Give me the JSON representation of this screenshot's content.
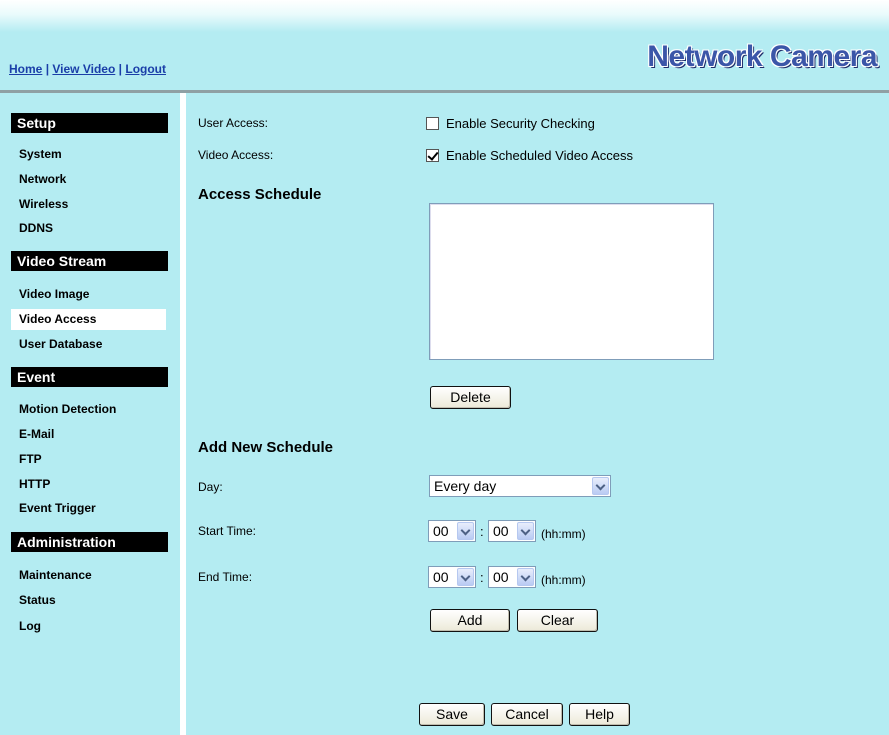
{
  "header": {
    "links": [
      "Home",
      "View Video",
      "Logout"
    ],
    "separator": "|",
    "brand": "Network Camera"
  },
  "sidebar": {
    "sections": [
      {
        "title": "Setup",
        "items": [
          "System",
          "Network",
          "Wireless",
          "DDNS"
        ]
      },
      {
        "title": "Video Stream",
        "items": [
          "Video Image",
          "Video Access",
          "User Database"
        ]
      },
      {
        "title": "Event",
        "items": [
          "Motion Detection",
          "E-Mail",
          "FTP",
          "HTTP",
          "Event Trigger"
        ]
      },
      {
        "title": "Administration",
        "items": [
          "Maintenance",
          "Status",
          "Log"
        ]
      }
    ],
    "active": "Video Access"
  },
  "main": {
    "user_access_label": "User Access:",
    "user_access_checkbox": "Enable Security Checking",
    "user_access_checked": false,
    "video_access_label": "Video Access:",
    "video_access_checkbox": "Enable Scheduled Video Access",
    "video_access_checked": true,
    "access_schedule_heading": "Access Schedule",
    "delete_button": "Delete",
    "add_schedule_heading": "Add New Schedule",
    "day_label": "Day:",
    "day_value": "Every day",
    "start_time_label": "Start Time:",
    "start_hour": "00",
    "start_minute": "00",
    "end_time_label": "End Time:",
    "end_hour": "00",
    "end_minute": "00",
    "time_colon": ":",
    "time_hint": "(hh:mm)",
    "add_button": "Add",
    "clear_button": "Clear",
    "save_button": "Save",
    "cancel_button": "Cancel",
    "help_button": "Help"
  }
}
